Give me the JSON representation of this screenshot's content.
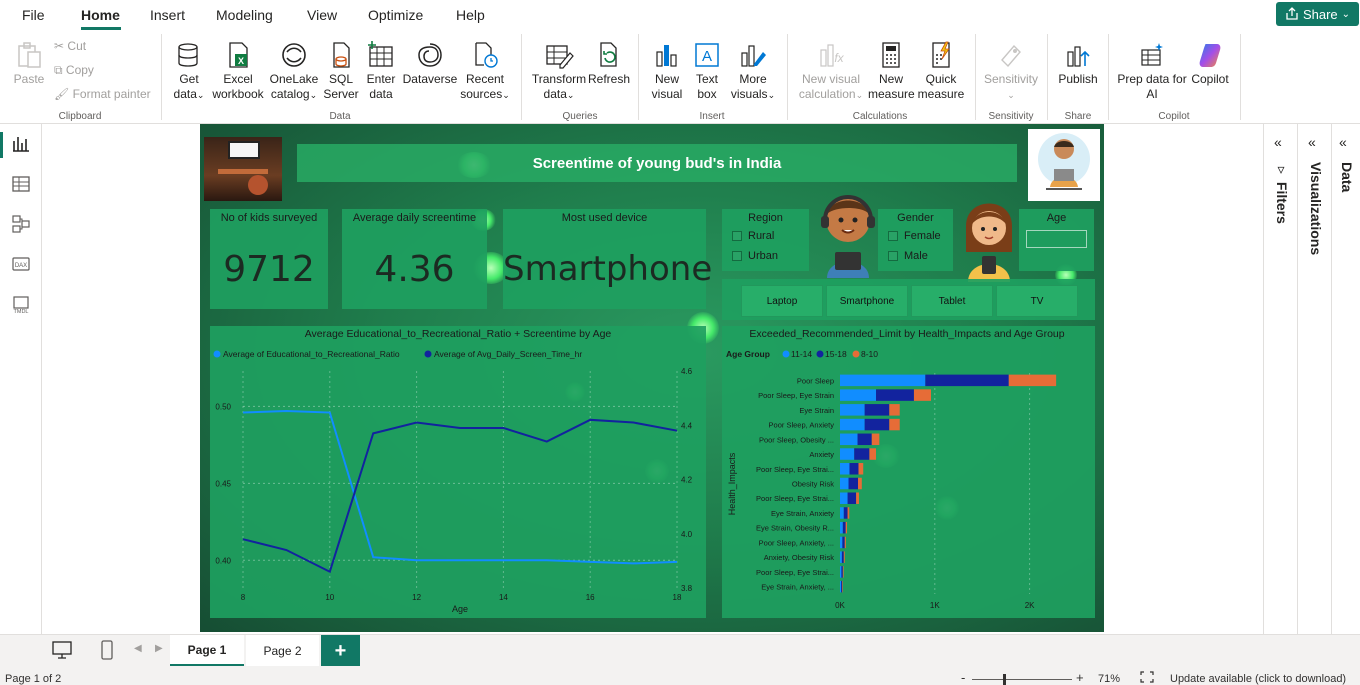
{
  "menu": {
    "file": "File",
    "home": "Home",
    "insert": "Insert",
    "modeling": "Modeling",
    "view": "View",
    "optimize": "Optimize",
    "help": "Help",
    "share": "Share"
  },
  "ribbon": {
    "paste": "Paste",
    "cut": "Cut",
    "copy": "Copy",
    "format_painter": "Format painter",
    "clipboard": "Clipboard",
    "get_data_1": "Get",
    "get_data_2": "data",
    "excel_1": "Excel",
    "excel_2": "workbook",
    "onelake_1": "OneLake",
    "onelake_2": "catalog",
    "sql_1": "SQL",
    "sql_2": "Server",
    "enter_1": "Enter",
    "enter_2": "data",
    "dataverse": "Dataverse",
    "recent_1": "Recent",
    "recent_2": "sources",
    "data_group": "Data",
    "transform_1": "Transform",
    "transform_2": "data",
    "refresh": "Refresh",
    "queries": "Queries",
    "newvisual_1": "New",
    "newvisual_2": "visual",
    "textbox_1": "Text",
    "textbox_2": "box",
    "more_1": "More",
    "more_2": "visuals",
    "insert_group": "Insert",
    "newcalc_1": "New visual",
    "newcalc_2": "calculation",
    "newmeasure_1": "New",
    "newmeasure_2": "measure",
    "quick_1": "Quick",
    "quick_2": "measure",
    "calculations": "Calculations",
    "sensitivity": "Sensitivity",
    "sensitivity_group": "Sensitivity",
    "publish": "Publish",
    "share_group": "Share",
    "copilot_1": "Prep data for",
    "copilot_2": "AI",
    "copilot": "Copilot",
    "copilot_group": "Copilot"
  },
  "panes": {
    "filters": "Filters",
    "visualizations": "Visualizations",
    "data": "Data"
  },
  "report": {
    "title": "Screentime of young bud's in India",
    "kpi1_label": "No of kids surveyed",
    "kpi1_value": "9712",
    "kpi2_label": "Average daily screentime",
    "kpi2_value": "4.36",
    "kpi3_label": "Most used device",
    "kpi3_value": "Smartphone",
    "region_label": "Region",
    "region_opts": [
      "Rural",
      "Urban"
    ],
    "gender_label": "Gender",
    "gender_opts": [
      "Female",
      "Male"
    ],
    "age_label": "Age",
    "devices": [
      "Laptop",
      "Smartphone",
      "Tablet",
      "TV"
    ]
  },
  "chart_data": [
    {
      "type": "line",
      "title": "Average Educational_to_Recreational_Ratio + Screentime by Age",
      "xlabel": "Age",
      "x": [
        8,
        9,
        10,
        11,
        12,
        13,
        14,
        15,
        16,
        17,
        18
      ],
      "series": [
        {
          "name": "Average of Educational_to_Recreational_Ratio",
          "axis": "left",
          "color": "#118dff",
          "values": [
            0.496,
            0.497,
            0.496,
            0.402,
            0.4,
            0.4,
            0.4,
            0.4,
            0.399,
            0.398,
            0.399
          ]
        },
        {
          "name": "Average of Avg_Daily_Screen_Time_hr",
          "axis": "right",
          "color": "#12239e",
          "values": [
            3.98,
            3.94,
            3.86,
            4.37,
            4.41,
            4.39,
            4.39,
            4.34,
            4.42,
            4.41,
            4.38
          ]
        }
      ],
      "yleft": {
        "ticks": [
          0.4,
          0.45,
          0.5
        ],
        "labels": [
          "0.40",
          "0.45",
          "0.50"
        ],
        "range": [
          0.382,
          0.523
        ]
      },
      "yright": {
        "ticks": [
          3.8,
          4.0,
          4.2,
          4.4,
          4.6
        ],
        "labels": [
          "3.8",
          "4.0",
          "4.2",
          "4.4",
          "4.6"
        ],
        "range": [
          3.8,
          4.6
        ]
      },
      "xticks": [
        8,
        10,
        12,
        14,
        16,
        18
      ]
    },
    {
      "type": "bar",
      "orientation": "horizontal",
      "stacked": true,
      "title": "Exceeded_Recommended_Limit by Health_Impacts and Age Group",
      "ylabel": "Health_Impacts",
      "legend_title": "Age Group",
      "categories": [
        "Poor Sleep",
        "Poor Sleep, Eye Strain",
        "Eye Strain",
        "Poor Sleep, Anxiety",
        "Poor Sleep, Obesity ...",
        "Anxiety",
        "Poor Sleep, Eye Strai...",
        "Obesity Risk",
        "Poor Sleep, Eye Strai...",
        "Eye Strain, Anxiety",
        "Eye Strain, Obesity R...",
        "Poor Sleep, Anxiety, ...",
        "Anxiety, Obesity Risk",
        "Poor Sleep, Eye Strai...",
        "Eye Strain, Anxiety, ..."
      ],
      "series": [
        {
          "name": "11-14",
          "color": "#118dff",
          "values": [
            900,
            380,
            260,
            260,
            185,
            150,
            100,
            90,
            80,
            40,
            30,
            25,
            20,
            15,
            12
          ]
        },
        {
          "name": "15-18",
          "color": "#12239e",
          "values": [
            880,
            400,
            260,
            260,
            150,
            160,
            95,
            100,
            90,
            40,
            30,
            25,
            20,
            15,
            12
          ]
        },
        {
          "name": "8-10",
          "color": "#e66c37",
          "values": [
            500,
            180,
            110,
            110,
            80,
            70,
            50,
            40,
            30,
            18,
            14,
            12,
            10,
            8,
            6
          ]
        }
      ],
      "xticks": [
        0,
        1000,
        2000
      ],
      "xtick_labels": [
        "0K",
        "1K",
        "2K"
      ],
      "xlim": [
        0,
        2500
      ]
    }
  ],
  "tabs": {
    "page1": "Page 1",
    "page2": "Page 2",
    "add": "+"
  },
  "status": {
    "page": "Page 1 of 2",
    "zoom": "71%",
    "update": "Update available (click to download)"
  }
}
